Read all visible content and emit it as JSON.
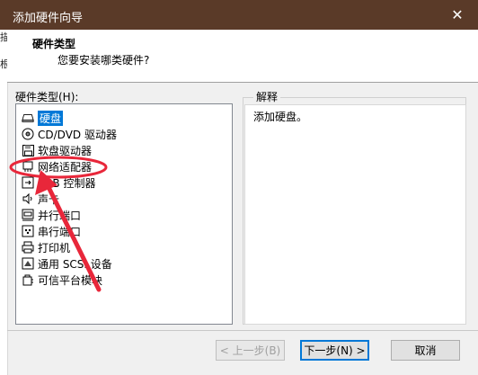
{
  "window": {
    "title": "添加硬件向导",
    "close_glyph": "✕"
  },
  "background_fragments": [
    "描",
    "根"
  ],
  "header": {
    "title": "硬件类型",
    "subtitle": "您要安装哪类硬件?"
  },
  "hardware_type_label": "硬件类型(H):",
  "hardware_items": [
    {
      "label": "硬盘",
      "icon": "hard-disk-icon",
      "selected": true
    },
    {
      "label": "CD/DVD 驱动器",
      "icon": "cd-dvd-icon",
      "selected": false
    },
    {
      "label": "软盘驱动器",
      "icon": "floppy-icon",
      "selected": false
    },
    {
      "label": "网络适配器",
      "icon": "network-adapter-icon",
      "selected": false
    },
    {
      "label": "USB 控制器",
      "icon": "usb-icon",
      "selected": false
    },
    {
      "label": "声卡",
      "icon": "speaker-icon",
      "selected": false
    },
    {
      "label": "并行端口",
      "icon": "parallel-port-icon",
      "selected": false
    },
    {
      "label": "串行端口",
      "icon": "serial-port-icon",
      "selected": false
    },
    {
      "label": "打印机",
      "icon": "printer-icon",
      "selected": false
    },
    {
      "label": "通用 SCSI 设备",
      "icon": "scsi-icon",
      "selected": false
    },
    {
      "label": "可信平台模块",
      "icon": "tpm-icon",
      "selected": false
    }
  ],
  "explanation": {
    "legend": "解释",
    "text": "添加硬盘。"
  },
  "buttons": {
    "back": "< 上一步(B)",
    "next": "下一步(N) >",
    "cancel": "取消"
  },
  "colors": {
    "titlebar": "#5a3a28",
    "selection": "#0078d7",
    "annotation": "#e8273a"
  }
}
